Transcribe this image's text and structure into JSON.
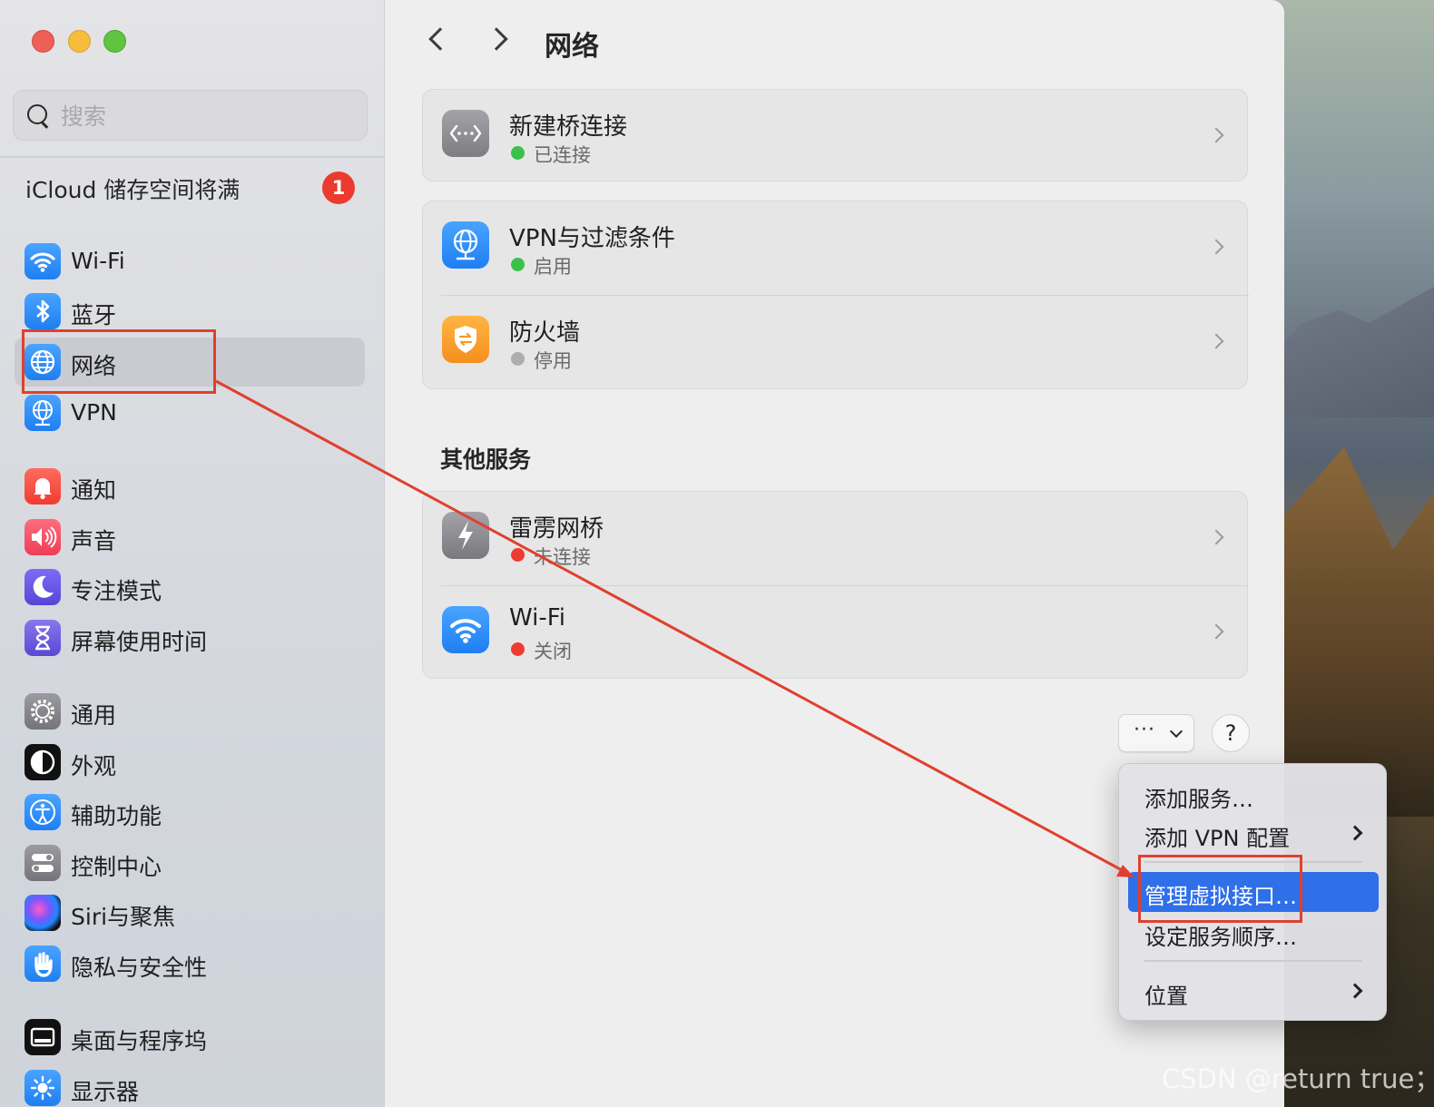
{
  "window": {
    "title": "网络"
  },
  "sidebar": {
    "search_placeholder": "搜索",
    "icloud_notice": "iCloud 储存空间将满",
    "icloud_badge": "1",
    "items": [
      {
        "label": "Wi-Fi",
        "icon": "wifi-icon"
      },
      {
        "label": "蓝牙",
        "icon": "bluetooth-icon"
      },
      {
        "label": "网络",
        "icon": "globe-icon",
        "selected": true
      },
      {
        "label": "VPN",
        "icon": "vpn-globe-icon"
      },
      {
        "label": "通知",
        "icon": "bell-icon"
      },
      {
        "label": "声音",
        "icon": "speaker-icon"
      },
      {
        "label": "专注模式",
        "icon": "moon-icon"
      },
      {
        "label": "屏幕使用时间",
        "icon": "hourglass-icon"
      },
      {
        "label": "通用",
        "icon": "gear-icon"
      },
      {
        "label": "外观",
        "icon": "appearance-icon"
      },
      {
        "label": "辅助功能",
        "icon": "accessibility-icon"
      },
      {
        "label": "控制中心",
        "icon": "toggles-icon"
      },
      {
        "label": "Siri与聚焦",
        "icon": "siri-icon"
      },
      {
        "label": "隐私与安全性",
        "icon": "hand-icon"
      },
      {
        "label": "桌面与程序坞",
        "icon": "dock-icon"
      },
      {
        "label": "显示器",
        "icon": "sun-icon"
      }
    ]
  },
  "main": {
    "services": [
      {
        "title": "新建桥连接",
        "status": "已连接",
        "status_color": "#3bc04a",
        "icon": "bridge-icon"
      },
      {
        "title": "VPN与过滤条件",
        "status": "启用",
        "status_color": "#3bc04a",
        "icon": "vpn-globe-icon"
      },
      {
        "title": "防火墙",
        "status": "停用",
        "status_color": "#adadaf",
        "icon": "firewall-shield-icon"
      }
    ],
    "other_section_title": "其他服务",
    "other_services": [
      {
        "title": "雷雳网桥",
        "status": "未连接",
        "status_color": "#ee3c32",
        "icon": "thunderbolt-icon"
      },
      {
        "title": "Wi-Fi",
        "status": "关闭",
        "status_color": "#ee3c32",
        "icon": "wifi-icon"
      }
    ],
    "more_button": "···",
    "help_button": "?"
  },
  "menu": {
    "items": [
      {
        "label": "添加服务…",
        "submenu": false
      },
      {
        "label": "添加 VPN 配置",
        "submenu": true
      },
      {
        "label": "管理虚拟接口…",
        "highlighted": true,
        "submenu": false
      },
      {
        "label": "设定服务顺序…",
        "submenu": false
      },
      {
        "label": "位置",
        "submenu": true
      }
    ]
  },
  "watermark": "CSDN @return true；",
  "colors": {
    "accent": "#2f6fe8",
    "annotation": "#e0402d"
  }
}
